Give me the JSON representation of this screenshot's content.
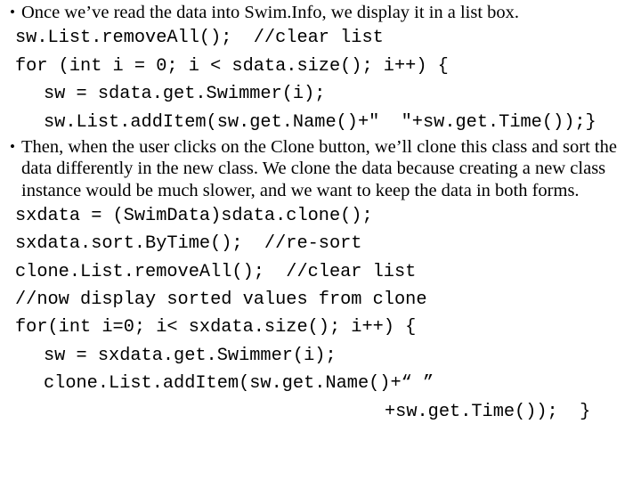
{
  "slide": {
    "blocks": [
      {
        "kind": "bullet",
        "marker": "•",
        "text": "Once we’ve read the data into Swim.Info, we display it in a list box."
      },
      {
        "kind": "code",
        "indent": 0,
        "text": "sw.List.removeAll();  //clear list"
      },
      {
        "kind": "code",
        "indent": 0,
        "text": "for (int i = 0; i < sdata.size(); i++) {"
      },
      {
        "kind": "code",
        "indent": 1,
        "text": "sw = sdata.get.Swimmer(i);"
      },
      {
        "kind": "code",
        "indent": 1,
        "text": "sw.List.addItem(sw.get.Name()+\"  \"+sw.get.Time());}"
      },
      {
        "kind": "bullet",
        "marker": "•",
        "text": "Then, when the user clicks on the Clone button, we’ll clone this class and sort the data differently in the new class. We clone the data because creating a new class instance would be much slower, and we want to keep the data in both forms."
      },
      {
        "kind": "code",
        "indent": 0,
        "text": "sxdata = (SwimData)sdata.clone();"
      },
      {
        "kind": "code",
        "indent": 0,
        "text": "sxdata.sort.ByTime();  //re-sort"
      },
      {
        "kind": "code",
        "indent": 0,
        "text": "clone.List.removeAll();  //clear list"
      },
      {
        "kind": "code",
        "indent": 0,
        "text": "//now display sorted values from clone"
      },
      {
        "kind": "code",
        "indent": 0,
        "text": "for(int i=0; i< sxdata.size(); i++) {"
      },
      {
        "kind": "code",
        "indent": 1,
        "text": "sw = sxdata.get.Swimmer(i);"
      },
      {
        "kind": "code",
        "indent": 1,
        "text": "clone.List.addItem(sw.get.Name()+“ ”"
      },
      {
        "kind": "code",
        "indent": "far",
        "text": "+sw.get.Time());  }"
      }
    ]
  }
}
